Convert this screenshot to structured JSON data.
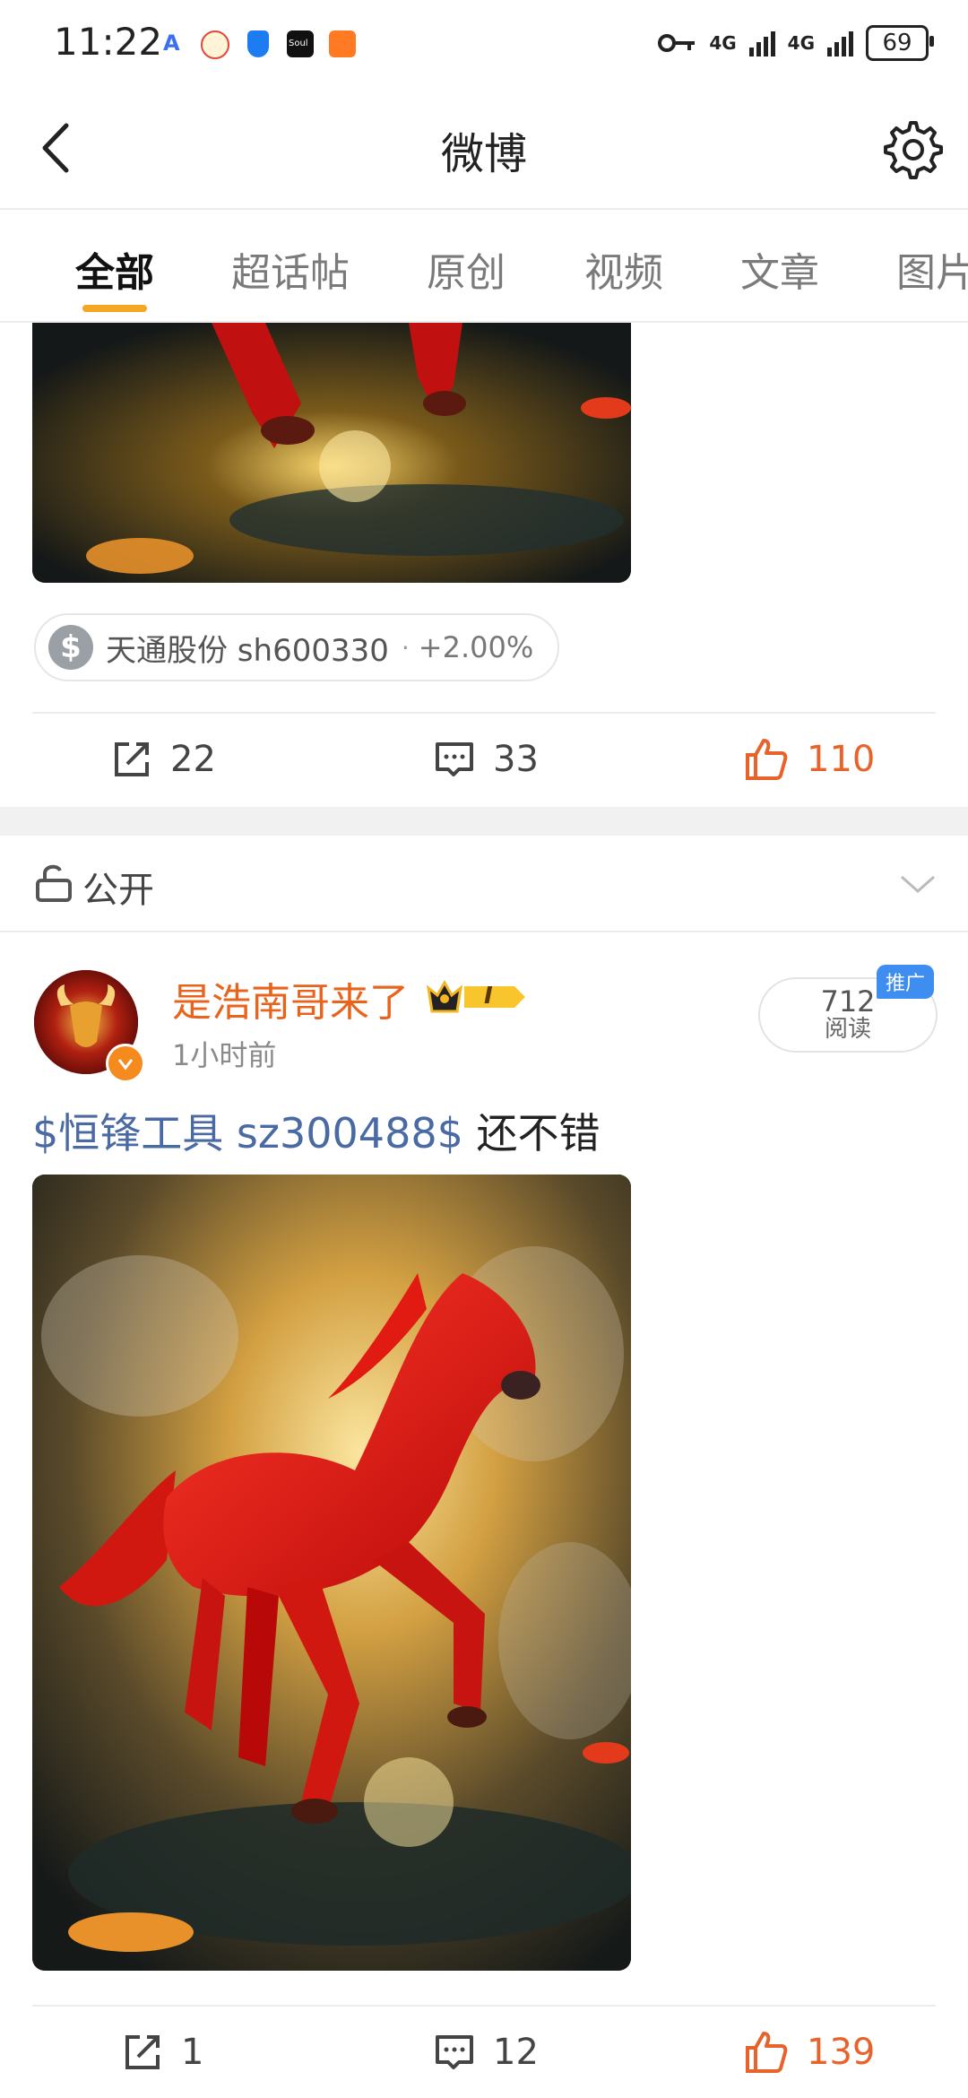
{
  "status_bar": {
    "time": "11:22",
    "a_label": "A",
    "soul_label": "Soul",
    "net1": "4G",
    "net2": "4G",
    "battery": "69"
  },
  "header": {
    "title": "微博"
  },
  "tabs": [
    {
      "label": "全部",
      "active": true
    },
    {
      "label": "超话帖"
    },
    {
      "label": "原创"
    },
    {
      "label": "视频"
    },
    {
      "label": "文章"
    },
    {
      "label": "图片"
    }
  ],
  "prev_post": {
    "stock_chip": {
      "name": "天通股份 sh600330",
      "dot": "·",
      "change": "+2.00%"
    },
    "actions": {
      "share": "22",
      "comment": "33",
      "like": "110"
    }
  },
  "visibility": {
    "label": "公开"
  },
  "post": {
    "username": "是浩南哥来了",
    "level_badge": "I",
    "time": "1小时前",
    "read_count": "712",
    "read_label": "阅读",
    "promo": "推广",
    "tag": "$恒锋工具 sz300488$",
    "text": " 还不错",
    "actions": {
      "share": "1",
      "comment": "12",
      "like": "139"
    }
  },
  "colors": {
    "accent": "#f5a623",
    "username": "#e8641c",
    "like": "#e8632b",
    "topic_link": "#4a6aa3"
  }
}
